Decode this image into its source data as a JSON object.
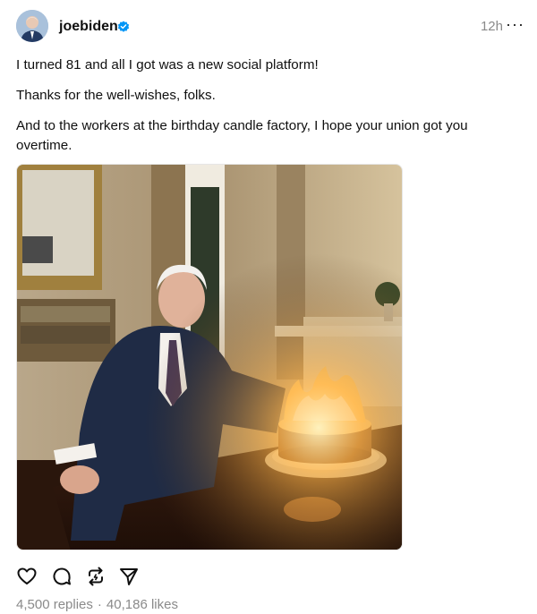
{
  "post": {
    "username": "joebiden",
    "time": "12h",
    "more": "···",
    "paragraphs": [
      "I turned 81 and all I got was a new social platform!",
      "Thanks for the well-wishes, folks.",
      "And to the workers at the birthday candle factory, I hope your union got you overtime."
    ],
    "replies": "4,500 replies",
    "separator": "·",
    "likes": "40,186 likes"
  },
  "icons": {
    "verified": "verified-badge-icon",
    "like": "heart-icon",
    "reply": "comment-icon",
    "repost": "repost-icon",
    "share": "send-icon"
  },
  "colors": {
    "verified": "#0095f6",
    "text": "#101010",
    "muted": "#8a8a8a"
  }
}
